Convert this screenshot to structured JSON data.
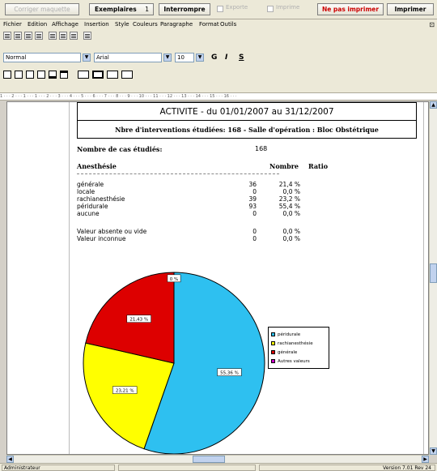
{
  "toolbar_top": {
    "configure_label": "Corriger maquette",
    "exemplaires_label": "Exemplaires",
    "exemplaires_count": "1",
    "interrompre_label": "Interrompre",
    "exporte_label": "Exporte",
    "imprime_label": "Imprime",
    "ne_pas_imprimer_label": "Ne pas imprimer",
    "imprimer_label": "Imprimer"
  },
  "menu": {
    "items": [
      "Fichier",
      "Edition",
      "Affichage",
      "Insertion",
      "Style",
      "Couleurs",
      "Paragraphe",
      "Format",
      "Outils"
    ],
    "close_glyph": "⊡"
  },
  "format_bar": {
    "style_value": "Normal",
    "font_value": "Arial",
    "size_value": "10",
    "bold_label": "G",
    "italic_label": "I",
    "underline_label": "S"
  },
  "ruler_text": "1 · · · 2 · · · 1 · · · 1 · · · 2 · · · 3 · · · 4 · · · 5 · · · 6 · · · 7 · · · 8 · · · 9 · · · 10 · · · 11 · · · 12 · · · 13 · · · 14 · · · 15 · · · 16 · · ·",
  "report": {
    "title": "ACTIVITE - du 01/01/2007 au 31/12/2007",
    "subtitle": "Nbre d'interventions étudiées: 168   -   Salle d'opération : Bloc Obstétrique",
    "cases_label": "Nombre de cas étudiés:",
    "cases_value": "168",
    "section_label": "Anesthésie",
    "col_nombre": "Nombre",
    "col_ratio": "Ratio",
    "rows": [
      {
        "label": "générale",
        "n": "36",
        "p": "21,4 %"
      },
      {
        "label": "locale",
        "n": "0",
        "p": "0,0 %"
      },
      {
        "label": "rachianesthésie",
        "n": "39",
        "p": "23,2 %"
      },
      {
        "label": "péridurale",
        "n": "93",
        "p": "55,4 %"
      },
      {
        "label": "aucune",
        "n": "0",
        "p": "0,0 %"
      }
    ],
    "rows2": [
      {
        "label": "Valeur absente ou vide",
        "n": "0",
        "p": "0,0 %"
      },
      {
        "label": "Valeur inconnue",
        "n": "0",
        "p": "0,0 %"
      }
    ]
  },
  "chart_data": {
    "type": "pie",
    "slices": [
      {
        "name": "péridurale",
        "value": 55.36,
        "label": "55,36 %",
        "color": "#2ec0f0"
      },
      {
        "name": "rachianesthésie",
        "value": 23.21,
        "label": "23,21 %",
        "color": "#ffff00"
      },
      {
        "name": "générale",
        "value": 21.43,
        "label": "21,43 %",
        "color": "#dd0000"
      },
      {
        "name": "Autres valeurs",
        "value": 0,
        "label": "0 %",
        "color": "#cc00cc"
      }
    ],
    "legend": [
      "péridurale",
      "rachianesthésie",
      "générale",
      "Autres valeurs"
    ],
    "legend_position": "right"
  },
  "status": {
    "user": "Administrateur",
    "version": "Version 7.01 Rev 24"
  }
}
